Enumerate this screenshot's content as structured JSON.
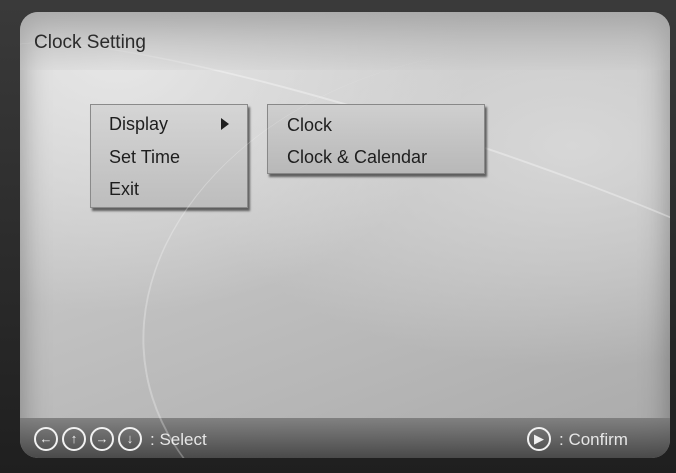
{
  "title": "Clock Setting",
  "menu": {
    "items": [
      {
        "label": "Display"
      },
      {
        "label": "Set Time"
      },
      {
        "label": "Exit"
      }
    ]
  },
  "submenu": {
    "items": [
      {
        "label": "Clock"
      },
      {
        "label": "Clock & Calendar"
      }
    ]
  },
  "footer": {
    "nav_buttons": [
      {
        "icon": "left-arrow-icon",
        "glyph": "←"
      },
      {
        "icon": "up-arrow-icon",
        "glyph": "↑"
      },
      {
        "icon": "right-arrow-icon",
        "glyph": "→"
      },
      {
        "icon": "down-arrow-icon",
        "glyph": "↓"
      }
    ],
    "select_label": ": Select",
    "confirm_icon_glyph": "▶",
    "confirm_label": ": Confirm"
  }
}
